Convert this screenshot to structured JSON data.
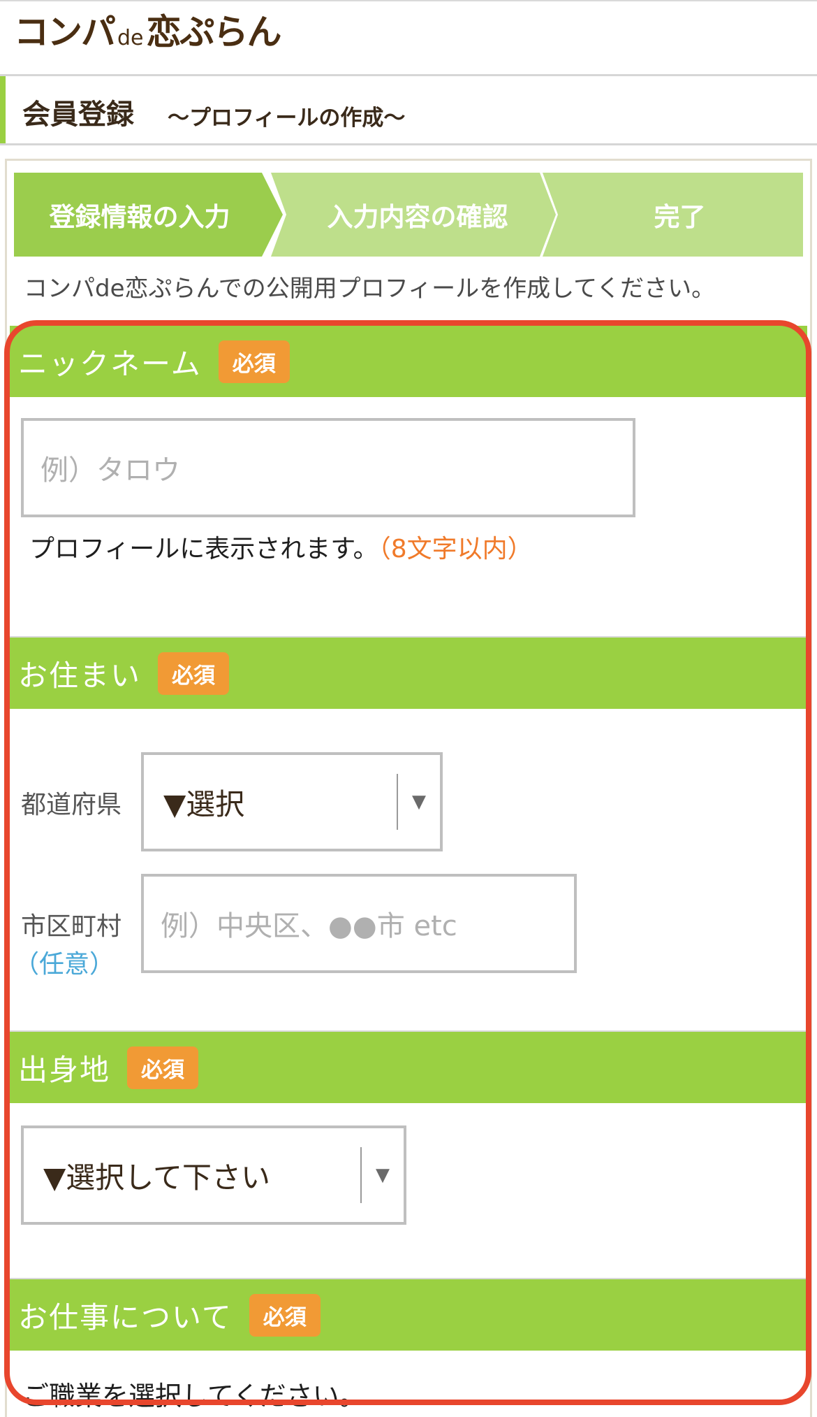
{
  "header": {
    "logo_main": "コンパ",
    "logo_de": "de",
    "logo_tail": "恋ぷらん"
  },
  "page_title": {
    "main": "会員登録",
    "sub": "〜プロフィールの作成〜"
  },
  "steps": [
    {
      "label": "登録情報の入力",
      "active": true
    },
    {
      "label": "入力内容の確認",
      "active": false
    },
    {
      "label": "完了",
      "active": false
    }
  ],
  "intro": "コンパde恋ぷらんでの公開用プロフィールを作成してください。",
  "sections": {
    "nickname": {
      "label": "ニックネーム",
      "badge": "必須",
      "placeholder": "例）タロウ",
      "note": "プロフィールに表示されます。",
      "note_limit": "（8文字以内）"
    },
    "residence": {
      "label": "お住まい",
      "badge": "必須",
      "prefecture_label": "都道府県",
      "prefecture_value": "▼選択",
      "city_label": "市区町村",
      "city_optional": "（任意）",
      "city_placeholder": "例）中央区、●●市 etc"
    },
    "birthplace": {
      "label": "出身地",
      "badge": "必須",
      "select_value": "▼選択して下さい"
    },
    "work": {
      "label": "お仕事について",
      "badge": "必須",
      "instruction": "ご職業を選択してください。"
    }
  },
  "colors": {
    "accent_green": "#9ad042",
    "step_inactive": "#bedf8b",
    "badge_orange": "#f19a35",
    "highlight_red": "#e8462d",
    "optional_blue": "#4aa8d8"
  }
}
